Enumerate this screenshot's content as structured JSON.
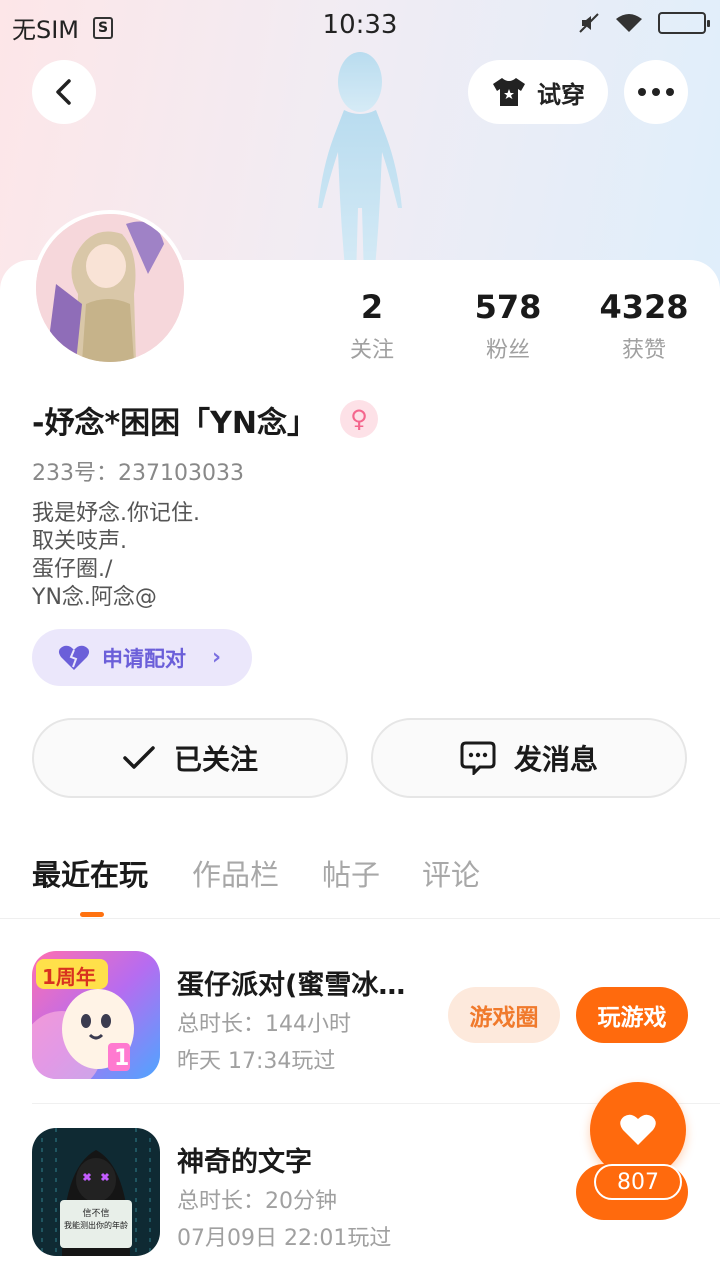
{
  "status_bar": {
    "carrier": "无SIM",
    "time": "10:33"
  },
  "header": {
    "try_on_label": "试穿"
  },
  "profile": {
    "stats": [
      {
        "value": "2",
        "label": "关注"
      },
      {
        "value": "578",
        "label": "粉丝"
      },
      {
        "value": "4328",
        "label": "获赞"
      }
    ],
    "name": "-妤念*困困「YN念」",
    "gender_symbol": "♀",
    "uid": "233号：237103033",
    "bio": [
      "我是妤念.你记住.",
      "取关吱声.",
      "蛋仔圈./",
      "YN念.阿念@"
    ],
    "pair_button": "申请配对"
  },
  "actions": {
    "followed": "已关注",
    "message": "发消息"
  },
  "tabs": [
    "最近在玩",
    "作品栏",
    "帖子",
    "评论"
  ],
  "games": [
    {
      "title": "蛋仔派对(蜜雪冰…",
      "duration": "总时长：144小时",
      "last_played": "昨天 17:34玩过",
      "circle_label": "游戏圈",
      "play_label": "玩游戏",
      "icon_text": "1周年"
    },
    {
      "title": "神奇的文字",
      "duration": "总时长：20分钟",
      "last_played": "07月09日 22:01玩过",
      "icon_text_1": "信不信",
      "icon_text_2": "我能测出你的年龄"
    }
  ],
  "fab": {
    "count": "807"
  },
  "colors": {
    "accent": "#ff6a0d",
    "pair": "#6b5fd9",
    "circle_bg": "#fde9dc",
    "circle_text": "#f07a2c"
  }
}
